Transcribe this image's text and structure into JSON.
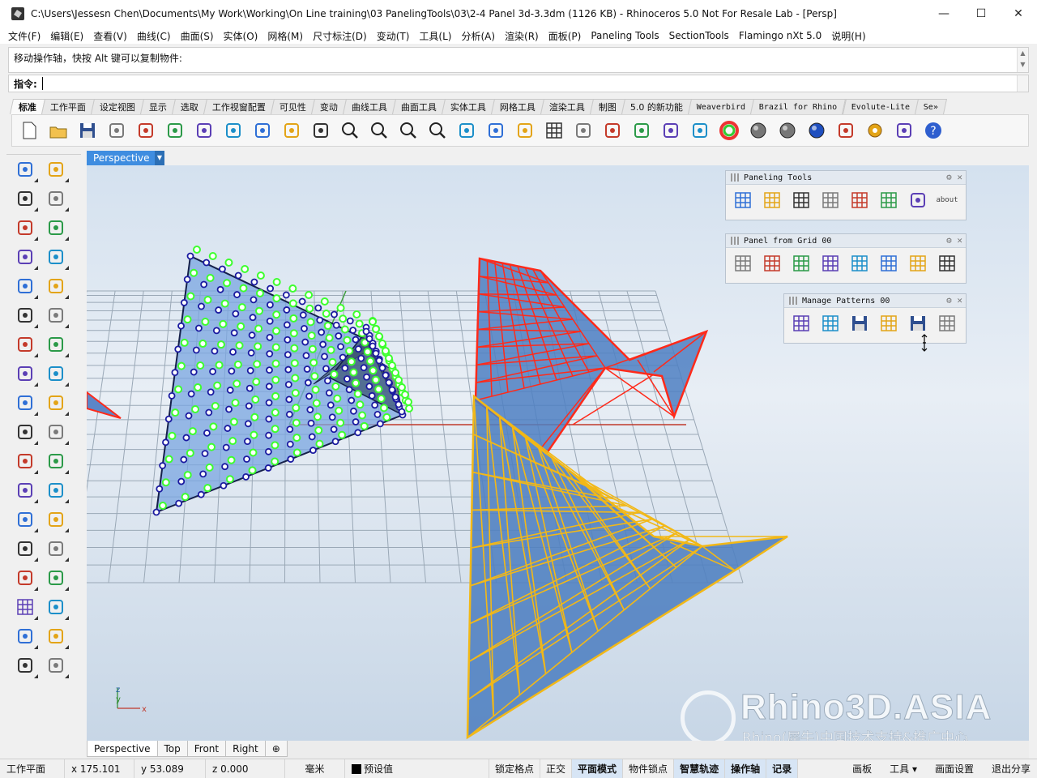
{
  "window": {
    "title": "C:\\Users\\Jessesn Chen\\Documents\\My Work\\Working\\On Line training\\03 PanelingTools\\03\\2-4 Panel 3d-3.3dm (1126 KB) - Rhinoceros 5.0 Not For Resale Lab - [Persp]",
    "minimize": "—",
    "maximize": "☐",
    "close": "✕"
  },
  "menu": [
    "文件(F)",
    "编辑(E)",
    "查看(V)",
    "曲线(C)",
    "曲面(S)",
    "实体(O)",
    "网格(M)",
    "尺寸标注(D)",
    "变动(T)",
    "工具(L)",
    "分析(A)",
    "渲染(R)",
    "面板(P)",
    "Paneling Tools",
    "SectionTools",
    "Flamingo nXt 5.0",
    "说明(H)"
  ],
  "command": {
    "history": "移动操作轴，快按 Alt 键可以复制物件:",
    "prompt": "指令:"
  },
  "tabs": [
    {
      "label": "标准",
      "active": true
    },
    {
      "label": "工作平面"
    },
    {
      "label": "设定视图"
    },
    {
      "label": "显示"
    },
    {
      "label": "选取"
    },
    {
      "label": "工作视窗配置"
    },
    {
      "label": "可见性"
    },
    {
      "label": "变动"
    },
    {
      "label": "曲线工具"
    },
    {
      "label": "曲面工具"
    },
    {
      "label": "实体工具"
    },
    {
      "label": "网格工具"
    },
    {
      "label": "渲染工具"
    },
    {
      "label": "制图"
    },
    {
      "label": "5.0 的新功能"
    },
    {
      "label": "Weaverbird",
      "mono": true
    },
    {
      "label": "Brazil for Rhino",
      "mono": true
    },
    {
      "label": "Evolute-Lite",
      "mono": true
    },
    {
      "label": "Se»",
      "mono": true
    }
  ],
  "toolbar_icons": [
    "new-file-icon",
    "open-folder-icon",
    "save-icon",
    "print-icon",
    "import-icon",
    "cut-icon",
    "copy-icon",
    "paste-icon",
    "undo-icon",
    "pan-hand-icon",
    "rotate-view-icon",
    "zoom-dynamic-icon",
    "zoom-window-icon",
    "zoom-extents-icon",
    "zoom-selected-icon",
    "undo-view-icon",
    "four-viewports-icon",
    "car-icon",
    "grid-plane-icon",
    "osnap-icon",
    "points-icon",
    "light-bulb-icon",
    "lock-icon",
    "render-material-icon",
    "color-wheel-icon",
    "shaded-sphere-icon",
    "rendered-sphere-icon",
    "blue-sphere-icon",
    "flamingo-icon",
    "options-gear-icon",
    "dimension-icon",
    "help-icon"
  ],
  "viewport": {
    "name": "Perspective",
    "axis_labels": {
      "z": "z",
      "y": "y",
      "x": "x"
    }
  },
  "panels": [
    {
      "title": "Paneling Tools",
      "icons": [
        "points-grid-icon",
        "grid-tool-icon",
        "triangle-panel-icon",
        "panel-3d-icon",
        "axis-grid-icon",
        "offset-grid-icon",
        "diamond-icon",
        "about-icon"
      ],
      "about": "about"
    },
    {
      "title": "Panel from Grid 00",
      "icons": [
        "panel-grid-a-icon",
        "panel-grid-b-icon",
        "panel-grid-c-icon",
        "panel-grid-d-icon",
        "panel-grid-e-icon",
        "panel-grid-f-icon",
        "panel-grid-g-icon",
        "panel-grid-h-icon"
      ]
    },
    {
      "title": "Manage Patterns 00",
      "icons": [
        "pattern-a-icon",
        "pattern-b-icon",
        "pattern-save-icon",
        "pattern-open-icon",
        "pattern-save2-icon",
        "pattern-open2-icon"
      ]
    }
  ],
  "viewport_tabs": [
    {
      "label": "Perspective",
      "active": true
    },
    {
      "label": "Top"
    },
    {
      "label": "Front"
    },
    {
      "label": "Right"
    },
    {
      "label": "⊕"
    }
  ],
  "status": {
    "cplane": "工作平面",
    "x": "x 175.101",
    "y": "y 53.089",
    "z": "z 0.000",
    "units": "毫米",
    "layer": "预设值",
    "toggles": [
      {
        "label": "锁定格点",
        "on": false
      },
      {
        "label": "正交",
        "on": false
      },
      {
        "label": "平面模式",
        "on": true
      },
      {
        "label": "物件锁点",
        "on": false
      },
      {
        "label": "智慧轨迹",
        "on": true
      },
      {
        "label": "操作轴",
        "on": true
      },
      {
        "label": "记录",
        "on": true
      }
    ],
    "right": [
      "画板",
      "工具 ▾",
      "画面设置",
      "退出分享"
    ]
  },
  "watermark": {
    "brand": "Rhino3D.ASIA",
    "sub": "Rhino(犀牛)中国技术支持&推广中心"
  },
  "colors": {
    "accent": "#3f8de0",
    "control_points_green": "#3dff2e",
    "control_points_blue": "#1a1aa0",
    "red_panel": "#ff2a1a",
    "yellow_panel": "#f2b817",
    "surface_blue": "#5d8fd0"
  }
}
